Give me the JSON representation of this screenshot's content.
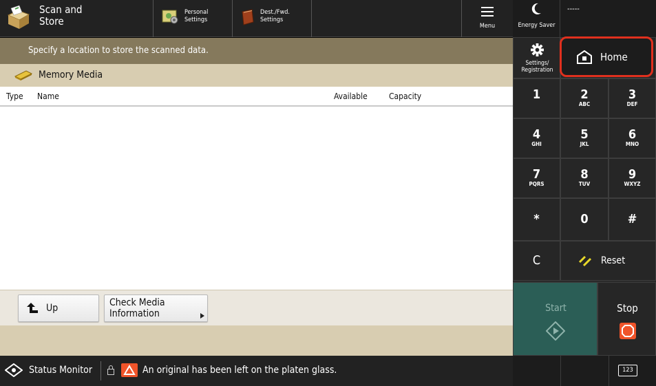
{
  "header": {
    "title_line1": "Scan and",
    "title_line2": "Store",
    "personal_settings_line1": "Personal",
    "personal_settings_line2": "Settings",
    "dest_fwd_line1": "Dest./Fwd.",
    "dest_fwd_line2": "Settings",
    "menu_label": "Menu"
  },
  "main": {
    "instruction": "Specify a location to store the scanned data.",
    "location": "Memory Media",
    "columns": [
      "Type",
      "Name",
      "Available",
      "Capacity"
    ]
  },
  "buttons": {
    "up": "Up",
    "check_media_line1": "Check Media",
    "check_media_line2": "Information"
  },
  "status": {
    "monitor": "Status Monitor",
    "message": "An original has been left on the platen glass."
  },
  "right_panel": {
    "energy_saver": "Energy Saver",
    "counter": "-----",
    "settings_line1": "Settings/",
    "settings_line2": "Registration",
    "home": "Home",
    "keys": [
      {
        "num": "1",
        "sub": ""
      },
      {
        "num": "2",
        "sub": "ABC"
      },
      {
        "num": "3",
        "sub": "DEF"
      },
      {
        "num": "4",
        "sub": "GHI"
      },
      {
        "num": "5",
        "sub": "JKL"
      },
      {
        "num": "6",
        "sub": "MNO"
      },
      {
        "num": "7",
        "sub": "PQRS"
      },
      {
        "num": "8",
        "sub": "TUV"
      },
      {
        "num": "9",
        "sub": "WXYZ"
      },
      {
        "num": "*",
        "sub": ""
      },
      {
        "num": "0",
        "sub": ""
      },
      {
        "num": "#",
        "sub": ""
      }
    ],
    "clear": "C",
    "reset": "Reset",
    "start": "Start",
    "stop": "Stop",
    "keypad_toggle": "123"
  },
  "colors": {
    "instruction_bar": "#85795c",
    "location_bar": "#d8cdb1",
    "start_button": "#2b5e56",
    "home_highlight": "#e0301e",
    "stop_icon": "#f0542a",
    "warning_icon": "#f0542a"
  }
}
